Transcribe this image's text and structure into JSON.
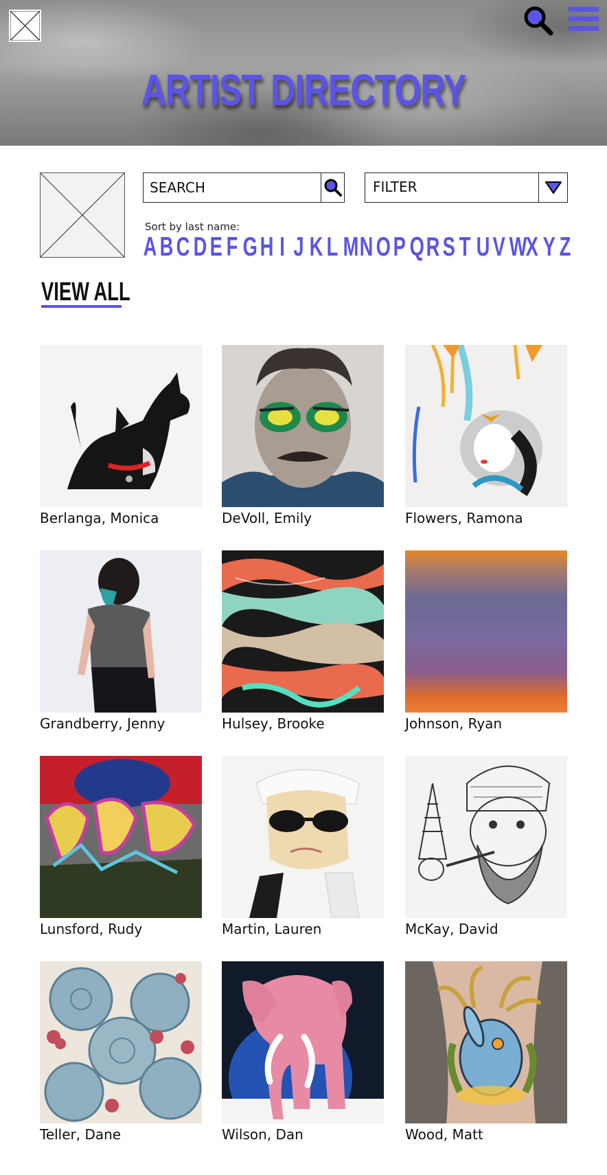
{
  "header": {
    "title": "ARTIST DIRECTORY",
    "accent": "#5b54e6",
    "icons": [
      "logo-placeholder-icon",
      "search-icon",
      "hamburger-menu-icon"
    ]
  },
  "controls": {
    "search_placeholder": "SEARCH",
    "filter_label": "FILTER",
    "sort_label": "Sort by last name:",
    "letters": [
      "A",
      "B",
      "C",
      "D",
      "E",
      "F",
      "G",
      "H",
      "I",
      "J",
      "K",
      "L",
      "M",
      "N",
      "O",
      "P",
      "Q",
      "R",
      "S",
      "T",
      "U",
      "V",
      "W",
      "X",
      "Y",
      "Z"
    ],
    "view_all": "VIEW ALL"
  },
  "artists": [
    {
      "name": "Berlanga, Monica",
      "art": "black-dog-portrait"
    },
    {
      "name": "DeVoll, Emily",
      "art": "man-with-galaxy-sunglasses"
    },
    {
      "name": "Flowers, Ramona",
      "art": "watercolor-woman-butterflies"
    },
    {
      "name": "Grandberry, Jenny",
      "art": "girl-with-teal-hair"
    },
    {
      "name": "Hulsey, Brooke",
      "art": "marbled-abstract"
    },
    {
      "name": "Johnson, Ryan",
      "art": "color-field-stripes"
    },
    {
      "name": "Lunsford, Rudy",
      "art": "graffiti-lettering"
    },
    {
      "name": "Martin, Lauren",
      "art": "man-in-dark-glasses-watercolor"
    },
    {
      "name": "McKay, David",
      "art": "bearded-man-pipe-sketch"
    },
    {
      "name": "Teller, Dane",
      "art": "stippled-roses"
    },
    {
      "name": "Wilson, Dan",
      "art": "pink-elephant"
    },
    {
      "name": "Wood, Matt",
      "art": "jackalope-tattoo"
    }
  ]
}
